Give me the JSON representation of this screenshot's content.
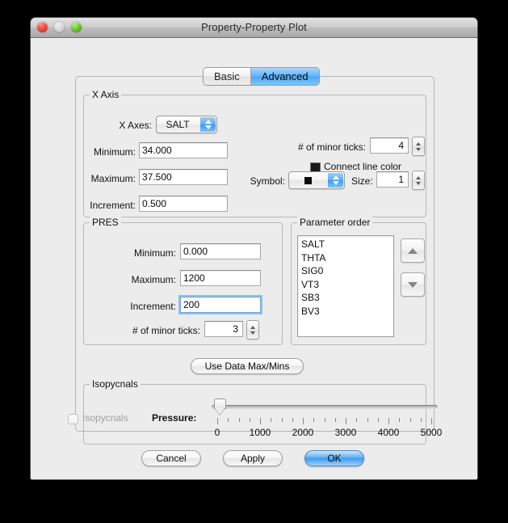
{
  "window": {
    "title": "Property-Property Plot",
    "controls": {
      "close": "close-button",
      "minimize": "minimize-button",
      "zoom": "zoom-button"
    }
  },
  "tabs": [
    {
      "label": "Basic",
      "selected": false
    },
    {
      "label": "Advanced",
      "selected": true
    }
  ],
  "x_axis": {
    "group_title": "X Axis",
    "axes_label": "X Axes:",
    "axes_value": "SALT",
    "minimum_label": "Minimum:",
    "minimum_value": "34.000",
    "maximum_label": "Maximum:",
    "maximum_value": "37.500",
    "increment_label": "Increment:",
    "increment_value": "0.500",
    "minor_ticks_label": "# of minor ticks:",
    "minor_ticks_value": "4",
    "connect_line_color_label": "Connect line color",
    "connect_line_color": "#1a1a1a",
    "symbol_label": "Symbol:",
    "symbol_value": "square",
    "size_label": "Size:",
    "size_value": "1"
  },
  "pres": {
    "group_title": "PRES",
    "minimum_label": "Minimum:",
    "minimum_value": "0.000",
    "maximum_label": "Maximum:",
    "maximum_value": "1200",
    "increment_label": "Increment:",
    "increment_value": "200",
    "minor_ticks_label": "# of minor ticks:",
    "minor_ticks_value": "3"
  },
  "parameter_order": {
    "group_title": "Parameter order",
    "items": [
      "SALT",
      "THTA",
      "SIG0",
      "VT3",
      "SB3",
      "BV3"
    ],
    "move_up": "move-up",
    "move_down": "move-down"
  },
  "use_data_max_mins_label": "Use Data Max/Mins",
  "isopycnals": {
    "group_title": "Isopycnals",
    "checkbox_label": "Isopycnals",
    "checked": false,
    "enabled": false,
    "pressure_label": "Pressure:",
    "slider": {
      "min": 0,
      "max": 5000,
      "value": 60,
      "tick_labels": [
        "0",
        "1000",
        "2000",
        "3000",
        "4000",
        "5000"
      ],
      "tick_values": [
        0,
        1000,
        2000,
        3000,
        4000,
        5000
      ],
      "minor_interval": 250
    }
  },
  "footer": {
    "cancel_label": "Cancel",
    "apply_label": "Apply",
    "ok_label": "OK"
  }
}
